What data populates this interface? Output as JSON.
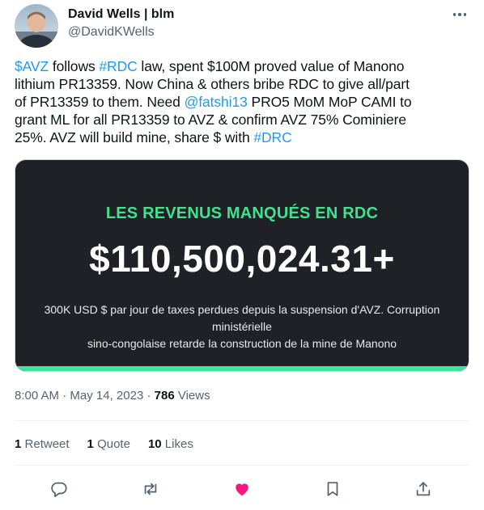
{
  "author": {
    "name": "David Wells | blm",
    "handle": "@DavidKWells"
  },
  "tweet": {
    "lines": [
      [
        {
          "t": "$AVZ",
          "link": true
        },
        {
          "t": " follows "
        },
        {
          "t": "#RDC",
          "link": true
        },
        {
          "t": " law, spent $100M proved value of Manono"
        }
      ],
      [
        {
          "t": "lithium PR13359. Now China & others bribe RDC to give all/part"
        }
      ],
      [
        {
          "t": "of PR13359 to them. Need "
        },
        {
          "t": "@fatshi13",
          "link": true
        },
        {
          "t": " PRO5 MoM MoP CAMI to"
        }
      ],
      [
        {
          "t": "grant ML for all PR13359 to AVZ & confirm AVZ 75% Cominiere"
        }
      ],
      [
        {
          "t": "25%. AVZ will build mine, share $ with "
        },
        {
          "t": "#DRC",
          "link": true
        }
      ]
    ]
  },
  "card": {
    "title": "LES REVENUS MANQUÉS EN RDC",
    "amount": "$110,500,024.31+",
    "desc_line1": "300K USD $ par jour de taxes perdues depuis la suspension d'AVZ. Corruption ministérielle",
    "desc_line2": "sino-congolaise retarde la construction de la mine de Manono",
    "bg_color": "#202127",
    "accent_color": "#3fe38e"
  },
  "meta": {
    "time": "8:00 AM",
    "date": "May 14, 2023",
    "views_count": "786",
    "views_label": "Views"
  },
  "stats": {
    "retweets_count": "1",
    "retweets_label": "Retweet",
    "quotes_count": "1",
    "quotes_label": "Quote",
    "likes_count": "10",
    "likes_label": "Likes"
  },
  "icons": {
    "reply": "reply-icon",
    "retweet": "retweet-icon",
    "like": "heart-icon",
    "bookmark": "bookmark-icon",
    "share": "share-icon",
    "more": "more-icon"
  },
  "colors": {
    "link": "#1d9bf0",
    "like_active": "#f91880",
    "muted": "#536471"
  }
}
